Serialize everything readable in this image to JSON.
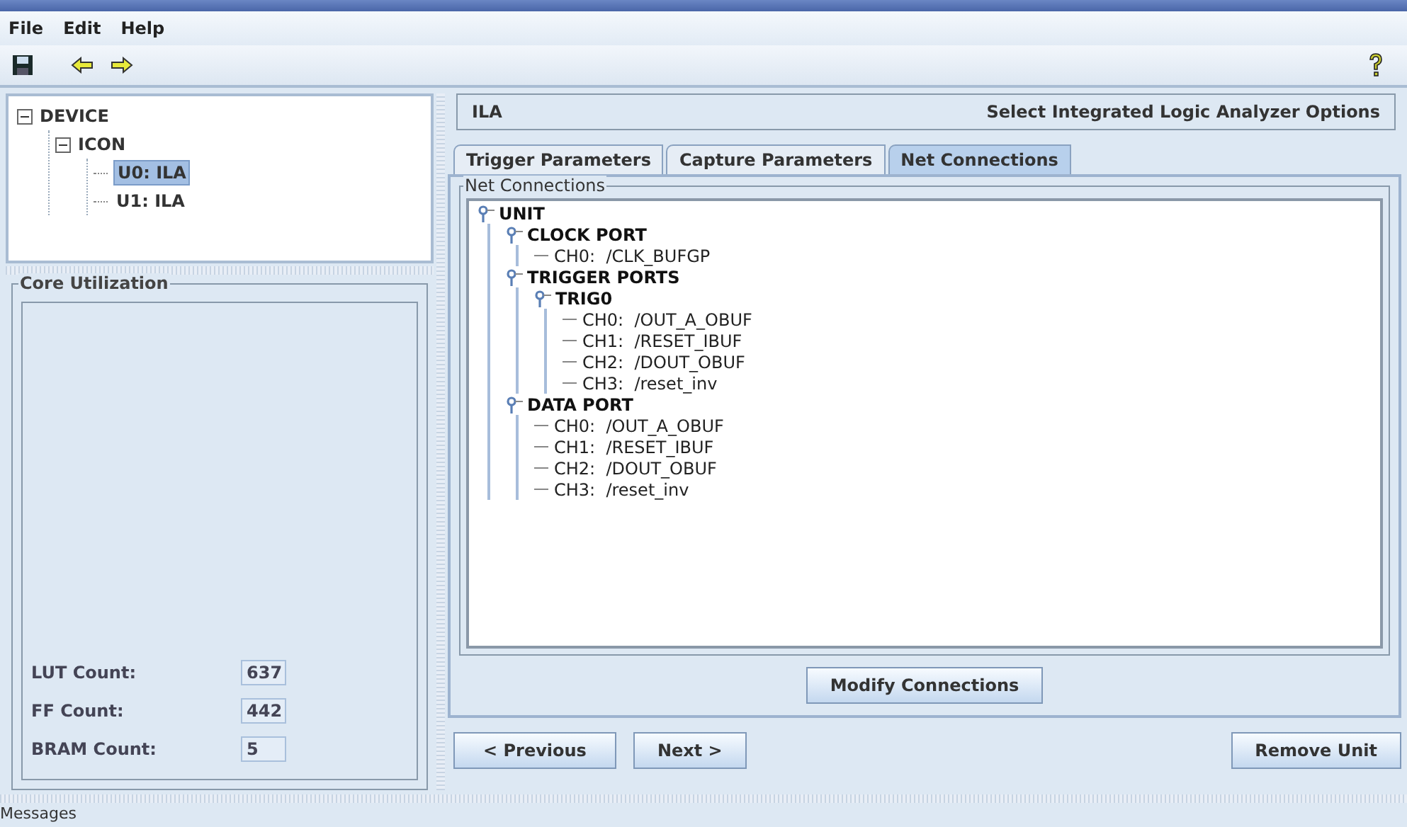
{
  "menu": [
    {
      "label": "File"
    },
    {
      "label": "Edit"
    },
    {
      "label": "Help"
    }
  ],
  "device_tree": [
    {
      "label": "DEVICE",
      "expanded": true,
      "selected": false,
      "children": [
        {
          "label": "ICON",
          "expanded": true,
          "selected": false,
          "children": [
            {
              "label": "U0: ILA",
              "selected": true
            },
            {
              "label": "U1: ILA",
              "selected": false
            }
          ]
        }
      ]
    }
  ],
  "core_utilization": {
    "title": "Core Utilization",
    "fields": [
      {
        "label": "LUT Count:",
        "value": "637"
      },
      {
        "label": "FF Count:",
        "value": "442"
      },
      {
        "label": "BRAM Count:",
        "value": "5"
      }
    ]
  },
  "header": {
    "name": "ILA",
    "description": "Select Integrated Logic Analyzer Options"
  },
  "tabs": [
    {
      "label": "Trigger Parameters",
      "selected": false
    },
    {
      "label": "Capture Parameters",
      "selected": false
    },
    {
      "label": "Net Connections",
      "selected": true
    }
  ],
  "net_connections": {
    "title": "Net Connections",
    "tree": [
      {
        "label": "UNIT",
        "expanded": true,
        "children": [
          {
            "label": "CLOCK PORT",
            "expanded": true,
            "children": [
              {
                "label": "CH0:  /CLK_BUFGP"
              }
            ]
          },
          {
            "label": "TRIGGER PORTS",
            "expanded": true,
            "children": [
              {
                "label": "TRIG0",
                "expanded": true,
                "children": [
                  {
                    "label": "CH0:  /OUT_A_OBUF"
                  },
                  {
                    "label": "CH1:  /RESET_IBUF"
                  },
                  {
                    "label": "CH2:  /DOUT_OBUF"
                  },
                  {
                    "label": "CH3:  /reset_inv"
                  }
                ]
              }
            ]
          },
          {
            "label": "DATA PORT",
            "expanded": true,
            "children": [
              {
                "label": "CH0:  /OUT_A_OBUF"
              },
              {
                "label": "CH1:  /RESET_IBUF"
              },
              {
                "label": "CH2:  /DOUT_OBUF"
              },
              {
                "label": "CH3:  /reset_inv"
              }
            ]
          }
        ]
      }
    ],
    "modify_button": "Modify Connections"
  },
  "nav_buttons": [
    "< Previous",
    "Next >"
  ],
  "remove_button": "Remove Unit",
  "messages_label": "Messages"
}
